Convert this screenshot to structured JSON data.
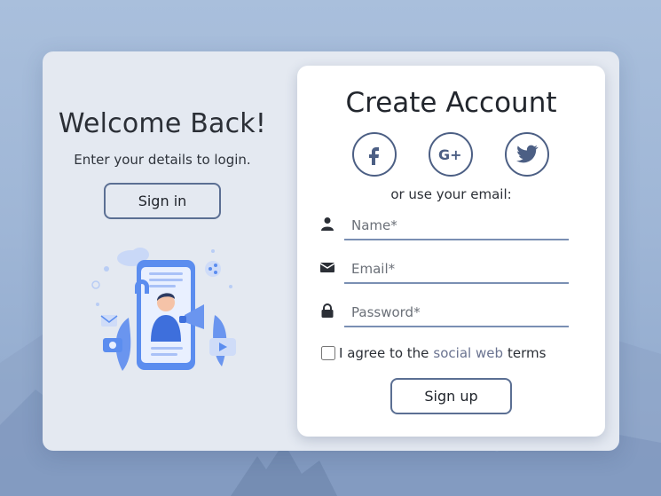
{
  "left": {
    "title": "Welcome Back!",
    "subtitle": "Enter your details to login.",
    "signin_label": "Sign in",
    "illustration": "person-with-megaphone-on-phone-illustration"
  },
  "right": {
    "title": "Create Account",
    "social": [
      {
        "icon": "facebook-icon"
      },
      {
        "icon": "google-plus-icon"
      },
      {
        "icon": "twitter-icon"
      }
    ],
    "or_text": "or use your email:",
    "fields": {
      "name_placeholder": "Name*",
      "email_placeholder": "Email*",
      "password_placeholder": "Password*"
    },
    "agree": {
      "prefix": "I agree to the",
      "link": "social web",
      "suffix": "terms",
      "checked": false
    },
    "signup_label": "Sign up"
  },
  "colors": {
    "accent_border": "#5b6f93",
    "card_bg": "#e4e9f1",
    "panel_bg": "#ffffff",
    "illustration_blue": "#5b8def"
  }
}
